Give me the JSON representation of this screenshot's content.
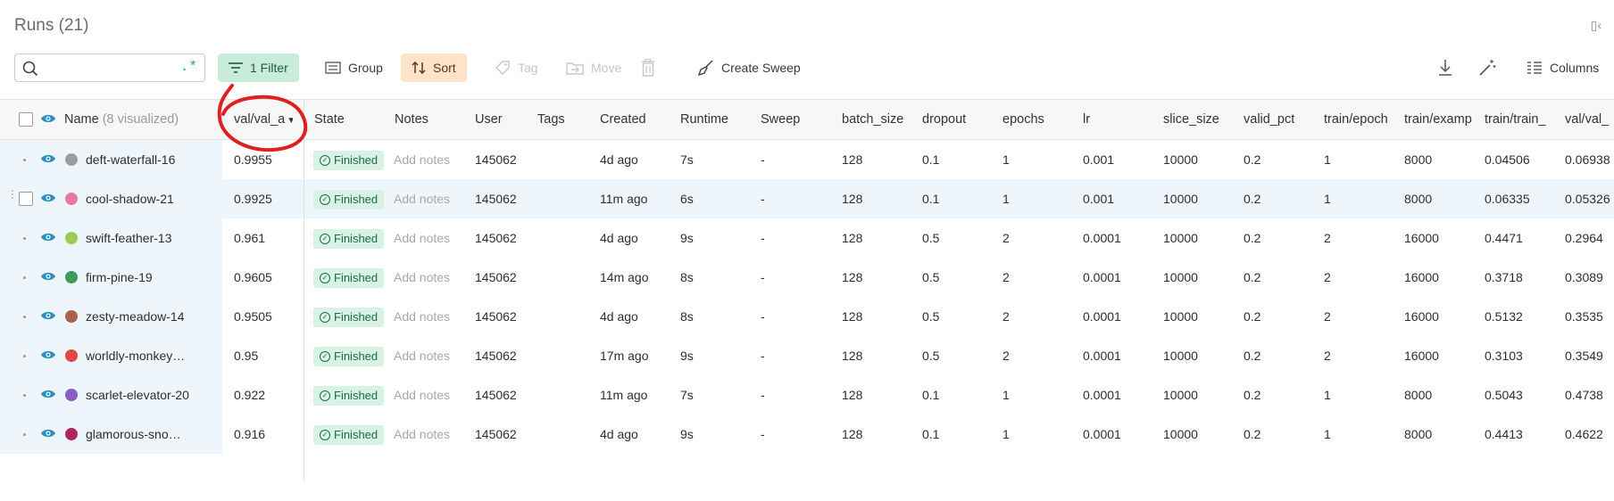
{
  "page": {
    "title": "Runs (21)"
  },
  "toolbar": {
    "search_placeholder": "",
    "regex_label": ".*",
    "filter_label": "1 Filter",
    "group_label": "Group",
    "sort_label": "Sort",
    "tag_label": "Tag",
    "move_label": "Move",
    "sweep_label": "Create Sweep",
    "columns_label": "Columns"
  },
  "table": {
    "headers": {
      "name": "Name",
      "visualized": "(8 visualized)",
      "val_acc": "val/val_a",
      "state": "State",
      "notes": "Notes",
      "user": "User",
      "tags": "Tags",
      "created": "Created",
      "runtime": "Runtime",
      "sweep": "Sweep",
      "batch_size": "batch_size",
      "dropout": "dropout",
      "epochs": "epochs",
      "lr": "lr",
      "slice_size": "slice_size",
      "valid_pct": "valid_pct",
      "train_epoch": "train/epoch",
      "train_examples": "train/examp",
      "train_train": "train/train_",
      "val_val": "val/val_"
    },
    "rows": [
      {
        "name": "deft-waterfall-16",
        "color": "#9e9e9e",
        "val": "0.9955",
        "state": "Finished",
        "notes": "Add notes",
        "user": "145062",
        "tags": "",
        "created": "4d ago",
        "runtime": "7s",
        "sweep": "-",
        "batch_size": "128",
        "dropout": "0.1",
        "epochs": "1",
        "lr": "0.001",
        "slice_size": "10000",
        "valid_pct": "0.2",
        "train_epoch": "1",
        "train_examples": "8000",
        "train_loss": "0.04506",
        "val_loss": "0.06938"
      },
      {
        "name": "cool-shadow-21",
        "color": "#e67aa3",
        "val": "0.9925",
        "state": "Finished",
        "notes": "Add notes",
        "user": "145062",
        "tags": "",
        "created": "11m ago",
        "runtime": "6s",
        "sweep": "-",
        "batch_size": "128",
        "dropout": "0.1",
        "epochs": "1",
        "lr": "0.001",
        "slice_size": "10000",
        "valid_pct": "0.2",
        "train_epoch": "1",
        "train_examples": "8000",
        "train_loss": "0.06335",
        "val_loss": "0.05326"
      },
      {
        "name": "swift-feather-13",
        "color": "#9ccc57",
        "val": "0.961",
        "state": "Finished",
        "notes": "Add notes",
        "user": "145062",
        "tags": "",
        "created": "4d ago",
        "runtime": "9s",
        "sweep": "-",
        "batch_size": "128",
        "dropout": "0.5",
        "epochs": "2",
        "lr": "0.0001",
        "slice_size": "10000",
        "valid_pct": "0.2",
        "train_epoch": "2",
        "train_examples": "16000",
        "train_loss": "0.4471",
        "val_loss": "0.2964"
      },
      {
        "name": "firm-pine-19",
        "color": "#3f9b5e",
        "val": "0.9605",
        "state": "Finished",
        "notes": "Add notes",
        "user": "145062",
        "tags": "",
        "created": "14m ago",
        "runtime": "8s",
        "sweep": "-",
        "batch_size": "128",
        "dropout": "0.5",
        "epochs": "2",
        "lr": "0.0001",
        "slice_size": "10000",
        "valid_pct": "0.2",
        "train_epoch": "2",
        "train_examples": "16000",
        "train_loss": "0.3718",
        "val_loss": "0.3089"
      },
      {
        "name": "zesty-meadow-14",
        "color": "#a8614d",
        "val": "0.9505",
        "state": "Finished",
        "notes": "Add notes",
        "user": "145062",
        "tags": "",
        "created": "4d ago",
        "runtime": "8s",
        "sweep": "-",
        "batch_size": "128",
        "dropout": "0.5",
        "epochs": "2",
        "lr": "0.0001",
        "slice_size": "10000",
        "valid_pct": "0.2",
        "train_epoch": "2",
        "train_examples": "16000",
        "train_loss": "0.5132",
        "val_loss": "0.3535"
      },
      {
        "name": "worldly-monkey…",
        "color": "#e04848",
        "val": "0.95",
        "state": "Finished",
        "notes": "Add notes",
        "user": "145062",
        "tags": "",
        "created": "17m ago",
        "runtime": "9s",
        "sweep": "-",
        "batch_size": "128",
        "dropout": "0.5",
        "epochs": "2",
        "lr": "0.0001",
        "slice_size": "10000",
        "valid_pct": "0.2",
        "train_epoch": "2",
        "train_examples": "16000",
        "train_loss": "0.3103",
        "val_loss": "0.3549"
      },
      {
        "name": "scarlet-elevator-20",
        "color": "#8a5cc6",
        "val": "0.922",
        "state": "Finished",
        "notes": "Add notes",
        "user": "145062",
        "tags": "",
        "created": "11m ago",
        "runtime": "7s",
        "sweep": "-",
        "batch_size": "128",
        "dropout": "0.1",
        "epochs": "1",
        "lr": "0.0001",
        "slice_size": "10000",
        "valid_pct": "0.2",
        "train_epoch": "1",
        "train_examples": "8000",
        "train_loss": "0.5043",
        "val_loss": "0.4738"
      },
      {
        "name": "glamorous-sno…",
        "color": "#b0265a",
        "val": "0.916",
        "state": "Finished",
        "notes": "Add notes",
        "user": "145062",
        "tags": "",
        "created": "4d ago",
        "runtime": "9s",
        "sweep": "-",
        "batch_size": "128",
        "dropout": "0.1",
        "epochs": "1",
        "lr": "0.0001",
        "slice_size": "10000",
        "valid_pct": "0.2",
        "train_epoch": "1",
        "train_examples": "8000",
        "train_loss": "0.4413",
        "val_loss": "0.4622"
      }
    ]
  },
  "annotation": {
    "color": "#e02020"
  }
}
